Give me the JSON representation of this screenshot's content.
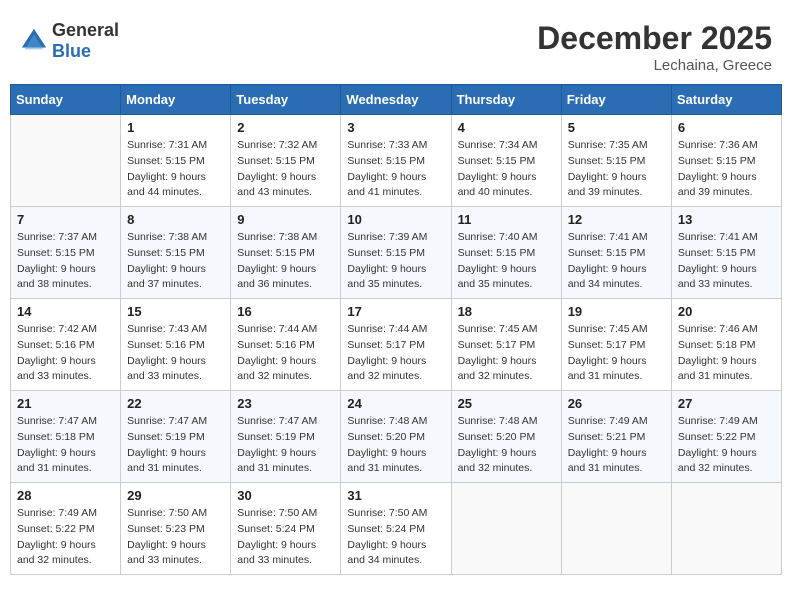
{
  "header": {
    "logo_general": "General",
    "logo_blue": "Blue",
    "month_year": "December 2025",
    "location": "Lechaina, Greece"
  },
  "weekdays": [
    "Sunday",
    "Monday",
    "Tuesday",
    "Wednesday",
    "Thursday",
    "Friday",
    "Saturday"
  ],
  "weeks": [
    [
      {
        "day": "",
        "sunrise": "",
        "sunset": "",
        "daylight": ""
      },
      {
        "day": "1",
        "sunrise": "Sunrise: 7:31 AM",
        "sunset": "Sunset: 5:15 PM",
        "daylight": "Daylight: 9 hours and 44 minutes."
      },
      {
        "day": "2",
        "sunrise": "Sunrise: 7:32 AM",
        "sunset": "Sunset: 5:15 PM",
        "daylight": "Daylight: 9 hours and 43 minutes."
      },
      {
        "day": "3",
        "sunrise": "Sunrise: 7:33 AM",
        "sunset": "Sunset: 5:15 PM",
        "daylight": "Daylight: 9 hours and 41 minutes."
      },
      {
        "day": "4",
        "sunrise": "Sunrise: 7:34 AM",
        "sunset": "Sunset: 5:15 PM",
        "daylight": "Daylight: 9 hours and 40 minutes."
      },
      {
        "day": "5",
        "sunrise": "Sunrise: 7:35 AM",
        "sunset": "Sunset: 5:15 PM",
        "daylight": "Daylight: 9 hours and 39 minutes."
      },
      {
        "day": "6",
        "sunrise": "Sunrise: 7:36 AM",
        "sunset": "Sunset: 5:15 PM",
        "daylight": "Daylight: 9 hours and 39 minutes."
      }
    ],
    [
      {
        "day": "7",
        "sunrise": "Sunrise: 7:37 AM",
        "sunset": "Sunset: 5:15 PM",
        "daylight": "Daylight: 9 hours and 38 minutes."
      },
      {
        "day": "8",
        "sunrise": "Sunrise: 7:38 AM",
        "sunset": "Sunset: 5:15 PM",
        "daylight": "Daylight: 9 hours and 37 minutes."
      },
      {
        "day": "9",
        "sunrise": "Sunrise: 7:38 AM",
        "sunset": "Sunset: 5:15 PM",
        "daylight": "Daylight: 9 hours and 36 minutes."
      },
      {
        "day": "10",
        "sunrise": "Sunrise: 7:39 AM",
        "sunset": "Sunset: 5:15 PM",
        "daylight": "Daylight: 9 hours and 35 minutes."
      },
      {
        "day": "11",
        "sunrise": "Sunrise: 7:40 AM",
        "sunset": "Sunset: 5:15 PM",
        "daylight": "Daylight: 9 hours and 35 minutes."
      },
      {
        "day": "12",
        "sunrise": "Sunrise: 7:41 AM",
        "sunset": "Sunset: 5:15 PM",
        "daylight": "Daylight: 9 hours and 34 minutes."
      },
      {
        "day": "13",
        "sunrise": "Sunrise: 7:41 AM",
        "sunset": "Sunset: 5:15 PM",
        "daylight": "Daylight: 9 hours and 33 minutes."
      }
    ],
    [
      {
        "day": "14",
        "sunrise": "Sunrise: 7:42 AM",
        "sunset": "Sunset: 5:16 PM",
        "daylight": "Daylight: 9 hours and 33 minutes."
      },
      {
        "day": "15",
        "sunrise": "Sunrise: 7:43 AM",
        "sunset": "Sunset: 5:16 PM",
        "daylight": "Daylight: 9 hours and 33 minutes."
      },
      {
        "day": "16",
        "sunrise": "Sunrise: 7:44 AM",
        "sunset": "Sunset: 5:16 PM",
        "daylight": "Daylight: 9 hours and 32 minutes."
      },
      {
        "day": "17",
        "sunrise": "Sunrise: 7:44 AM",
        "sunset": "Sunset: 5:17 PM",
        "daylight": "Daylight: 9 hours and 32 minutes."
      },
      {
        "day": "18",
        "sunrise": "Sunrise: 7:45 AM",
        "sunset": "Sunset: 5:17 PM",
        "daylight": "Daylight: 9 hours and 32 minutes."
      },
      {
        "day": "19",
        "sunrise": "Sunrise: 7:45 AM",
        "sunset": "Sunset: 5:17 PM",
        "daylight": "Daylight: 9 hours and 31 minutes."
      },
      {
        "day": "20",
        "sunrise": "Sunrise: 7:46 AM",
        "sunset": "Sunset: 5:18 PM",
        "daylight": "Daylight: 9 hours and 31 minutes."
      }
    ],
    [
      {
        "day": "21",
        "sunrise": "Sunrise: 7:47 AM",
        "sunset": "Sunset: 5:18 PM",
        "daylight": "Daylight: 9 hours and 31 minutes."
      },
      {
        "day": "22",
        "sunrise": "Sunrise: 7:47 AM",
        "sunset": "Sunset: 5:19 PM",
        "daylight": "Daylight: 9 hours and 31 minutes."
      },
      {
        "day": "23",
        "sunrise": "Sunrise: 7:47 AM",
        "sunset": "Sunset: 5:19 PM",
        "daylight": "Daylight: 9 hours and 31 minutes."
      },
      {
        "day": "24",
        "sunrise": "Sunrise: 7:48 AM",
        "sunset": "Sunset: 5:20 PM",
        "daylight": "Daylight: 9 hours and 31 minutes."
      },
      {
        "day": "25",
        "sunrise": "Sunrise: 7:48 AM",
        "sunset": "Sunset: 5:20 PM",
        "daylight": "Daylight: 9 hours and 32 minutes."
      },
      {
        "day": "26",
        "sunrise": "Sunrise: 7:49 AM",
        "sunset": "Sunset: 5:21 PM",
        "daylight": "Daylight: 9 hours and 31 minutes."
      },
      {
        "day": "27",
        "sunrise": "Sunrise: 7:49 AM",
        "sunset": "Sunset: 5:22 PM",
        "daylight": "Daylight: 9 hours and 32 minutes."
      }
    ],
    [
      {
        "day": "28",
        "sunrise": "Sunrise: 7:49 AM",
        "sunset": "Sunset: 5:22 PM",
        "daylight": "Daylight: 9 hours and 32 minutes."
      },
      {
        "day": "29",
        "sunrise": "Sunrise: 7:50 AM",
        "sunset": "Sunset: 5:23 PM",
        "daylight": "Daylight: 9 hours and 33 minutes."
      },
      {
        "day": "30",
        "sunrise": "Sunrise: 7:50 AM",
        "sunset": "Sunset: 5:24 PM",
        "daylight": "Daylight: 9 hours and 33 minutes."
      },
      {
        "day": "31",
        "sunrise": "Sunrise: 7:50 AM",
        "sunset": "Sunset: 5:24 PM",
        "daylight": "Daylight: 9 hours and 34 minutes."
      },
      {
        "day": "",
        "sunrise": "",
        "sunset": "",
        "daylight": ""
      },
      {
        "day": "",
        "sunrise": "",
        "sunset": "",
        "daylight": ""
      },
      {
        "day": "",
        "sunrise": "",
        "sunset": "",
        "daylight": ""
      }
    ]
  ]
}
